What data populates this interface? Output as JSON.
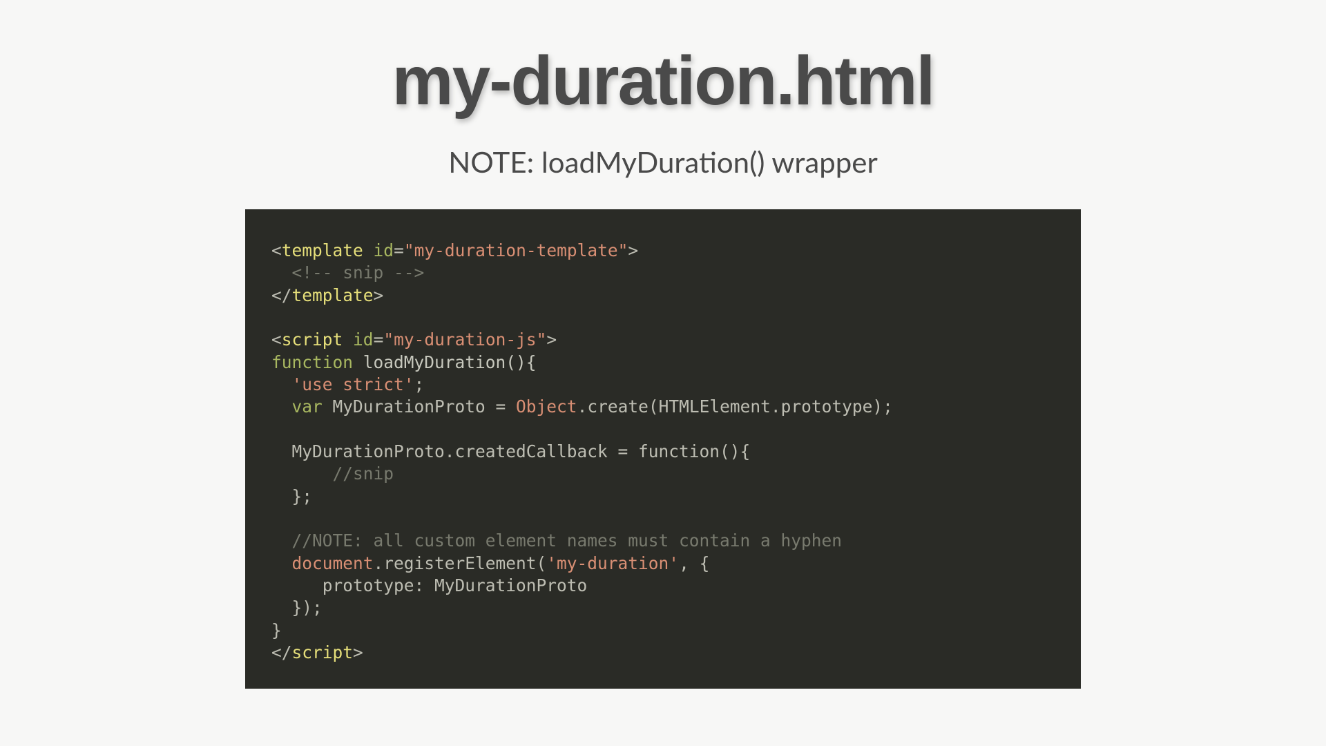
{
  "slide": {
    "title": "my-duration.html",
    "subtitle": "NOTE: loadMyDuration() wrapper"
  },
  "code": {
    "l01a": "<",
    "l01b": "template",
    "l01c": " ",
    "l01d": "id",
    "l01e": "=",
    "l01f": "\"my-duration-template\"",
    "l01g": ">",
    "l02": "  <!-- snip -->",
    "l03a": "</",
    "l03b": "template",
    "l03c": ">",
    "l05a": "<",
    "l05b": "script",
    "l05c": " ",
    "l05d": "id",
    "l05e": "=",
    "l05f": "\"my-duration-js\"",
    "l05g": ">",
    "l06a": "function",
    "l06b": " loadMyDuration(){",
    "l07a": "  ",
    "l07b": "'use strict'",
    "l07c": ";",
    "l08a": "  ",
    "l08b": "var",
    "l08c": " MyDurationProto = ",
    "l08d": "Object",
    "l08e": ".create(HTMLElement.prototype);",
    "l10": "  MyDurationProto.createdCallback = function(){",
    "l11": "      //snip",
    "l12": "  };",
    "l14": "  //NOTE: all custom element names must contain a hyphen",
    "l15a": "  ",
    "l15b": "document",
    "l15c": ".registerElement(",
    "l15d": "'my-duration'",
    "l15e": ", {",
    "l16": "     prototype: MyDurationProto",
    "l17": "  });",
    "l18": "}",
    "l19a": "</",
    "l19b": "script",
    "l19c": ">"
  }
}
